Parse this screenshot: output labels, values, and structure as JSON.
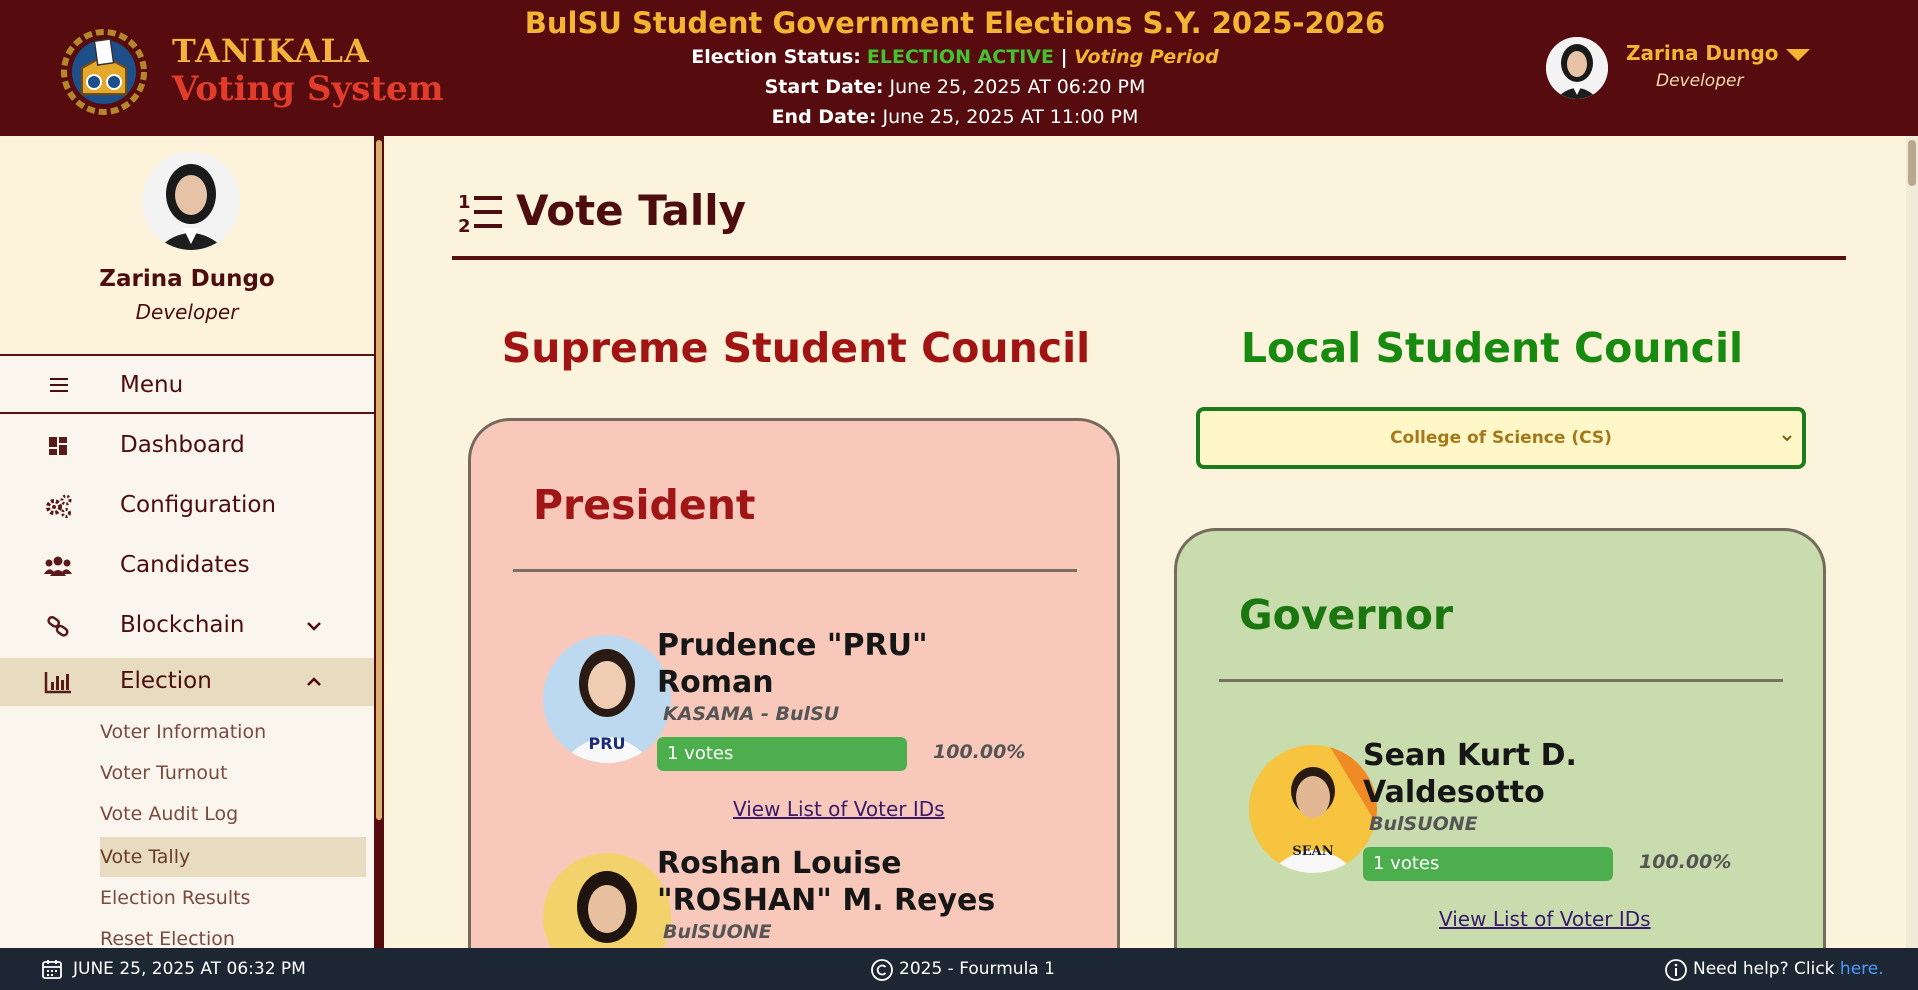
{
  "header": {
    "logo_line1": "TANIKALA",
    "logo_line2": "Voting System",
    "title": "BulSU Student Government Elections S.Y. 2025-2026",
    "status_label": "Election Status:",
    "status_value": "ELECTION ACTIVE",
    "status_sep": " | ",
    "status_period": "Voting Period",
    "start_label": "Start Date:",
    "start_value": "June 25, 2025 AT 06:20 PM",
    "end_label": "End Date:",
    "end_value": "June 25, 2025 AT 11:00 PM",
    "user_name": "Zarina Dungo",
    "user_role": "Developer"
  },
  "sidebar": {
    "profile_name": "Zarina Dungo",
    "profile_role": "Developer",
    "menu_label": "Menu",
    "items": [
      {
        "label": "Dashboard",
        "icon": "dashboard-icon"
      },
      {
        "label": "Configuration",
        "icon": "gears-icon"
      },
      {
        "label": "Candidates",
        "icon": "users-icon"
      },
      {
        "label": "Blockchain",
        "icon": "link-icon"
      },
      {
        "label": "Election",
        "icon": "chart-bar-icon"
      }
    ],
    "sub_items": [
      "Voter Information",
      "Voter Turnout",
      "Vote Audit Log",
      "Vote Tally",
      "Election Results",
      "Reset Election"
    ]
  },
  "main": {
    "page_title": "Vote Tally",
    "ssc_title": "Supreme Student Council",
    "lsc_title": "Local Student Council",
    "college_selected": "College of Science (CS)",
    "ssc_position": "President",
    "lsc_position": "Governor",
    "ssc_candidates": [
      {
        "name": "Prudence \"PRU\" Roman",
        "party": "KASAMA - BulSU",
        "votes": "1 votes",
        "vote_fraction": 1.0,
        "percent": "100.00%",
        "link": "View List of Voter IDs"
      },
      {
        "name": "Roshan Louise \"ROSHAN\" M. Reyes",
        "party": "BulSUONE"
      }
    ],
    "lsc_candidates": [
      {
        "name": "Sean Kurt D. Valdesotto",
        "party": "BulSUONE",
        "votes": "1 votes",
        "vote_fraction": 1.0,
        "percent": "100.00%",
        "link": "View List of Voter IDs"
      }
    ]
  },
  "footer": {
    "datetime": "JUNE 25, 2025 AT 06:32 PM",
    "copyright": "2025 - Fourmula 1",
    "help_text": "Need help? Click ",
    "help_link": "here."
  },
  "colors": {
    "header_bg": "#560c0e",
    "accent_gold": "#f5b533",
    "ssc_red": "#a11414",
    "lsc_green": "#188a10",
    "vote_bar_green": "#4cae4c",
    "footer_bg": "#1c2733"
  }
}
